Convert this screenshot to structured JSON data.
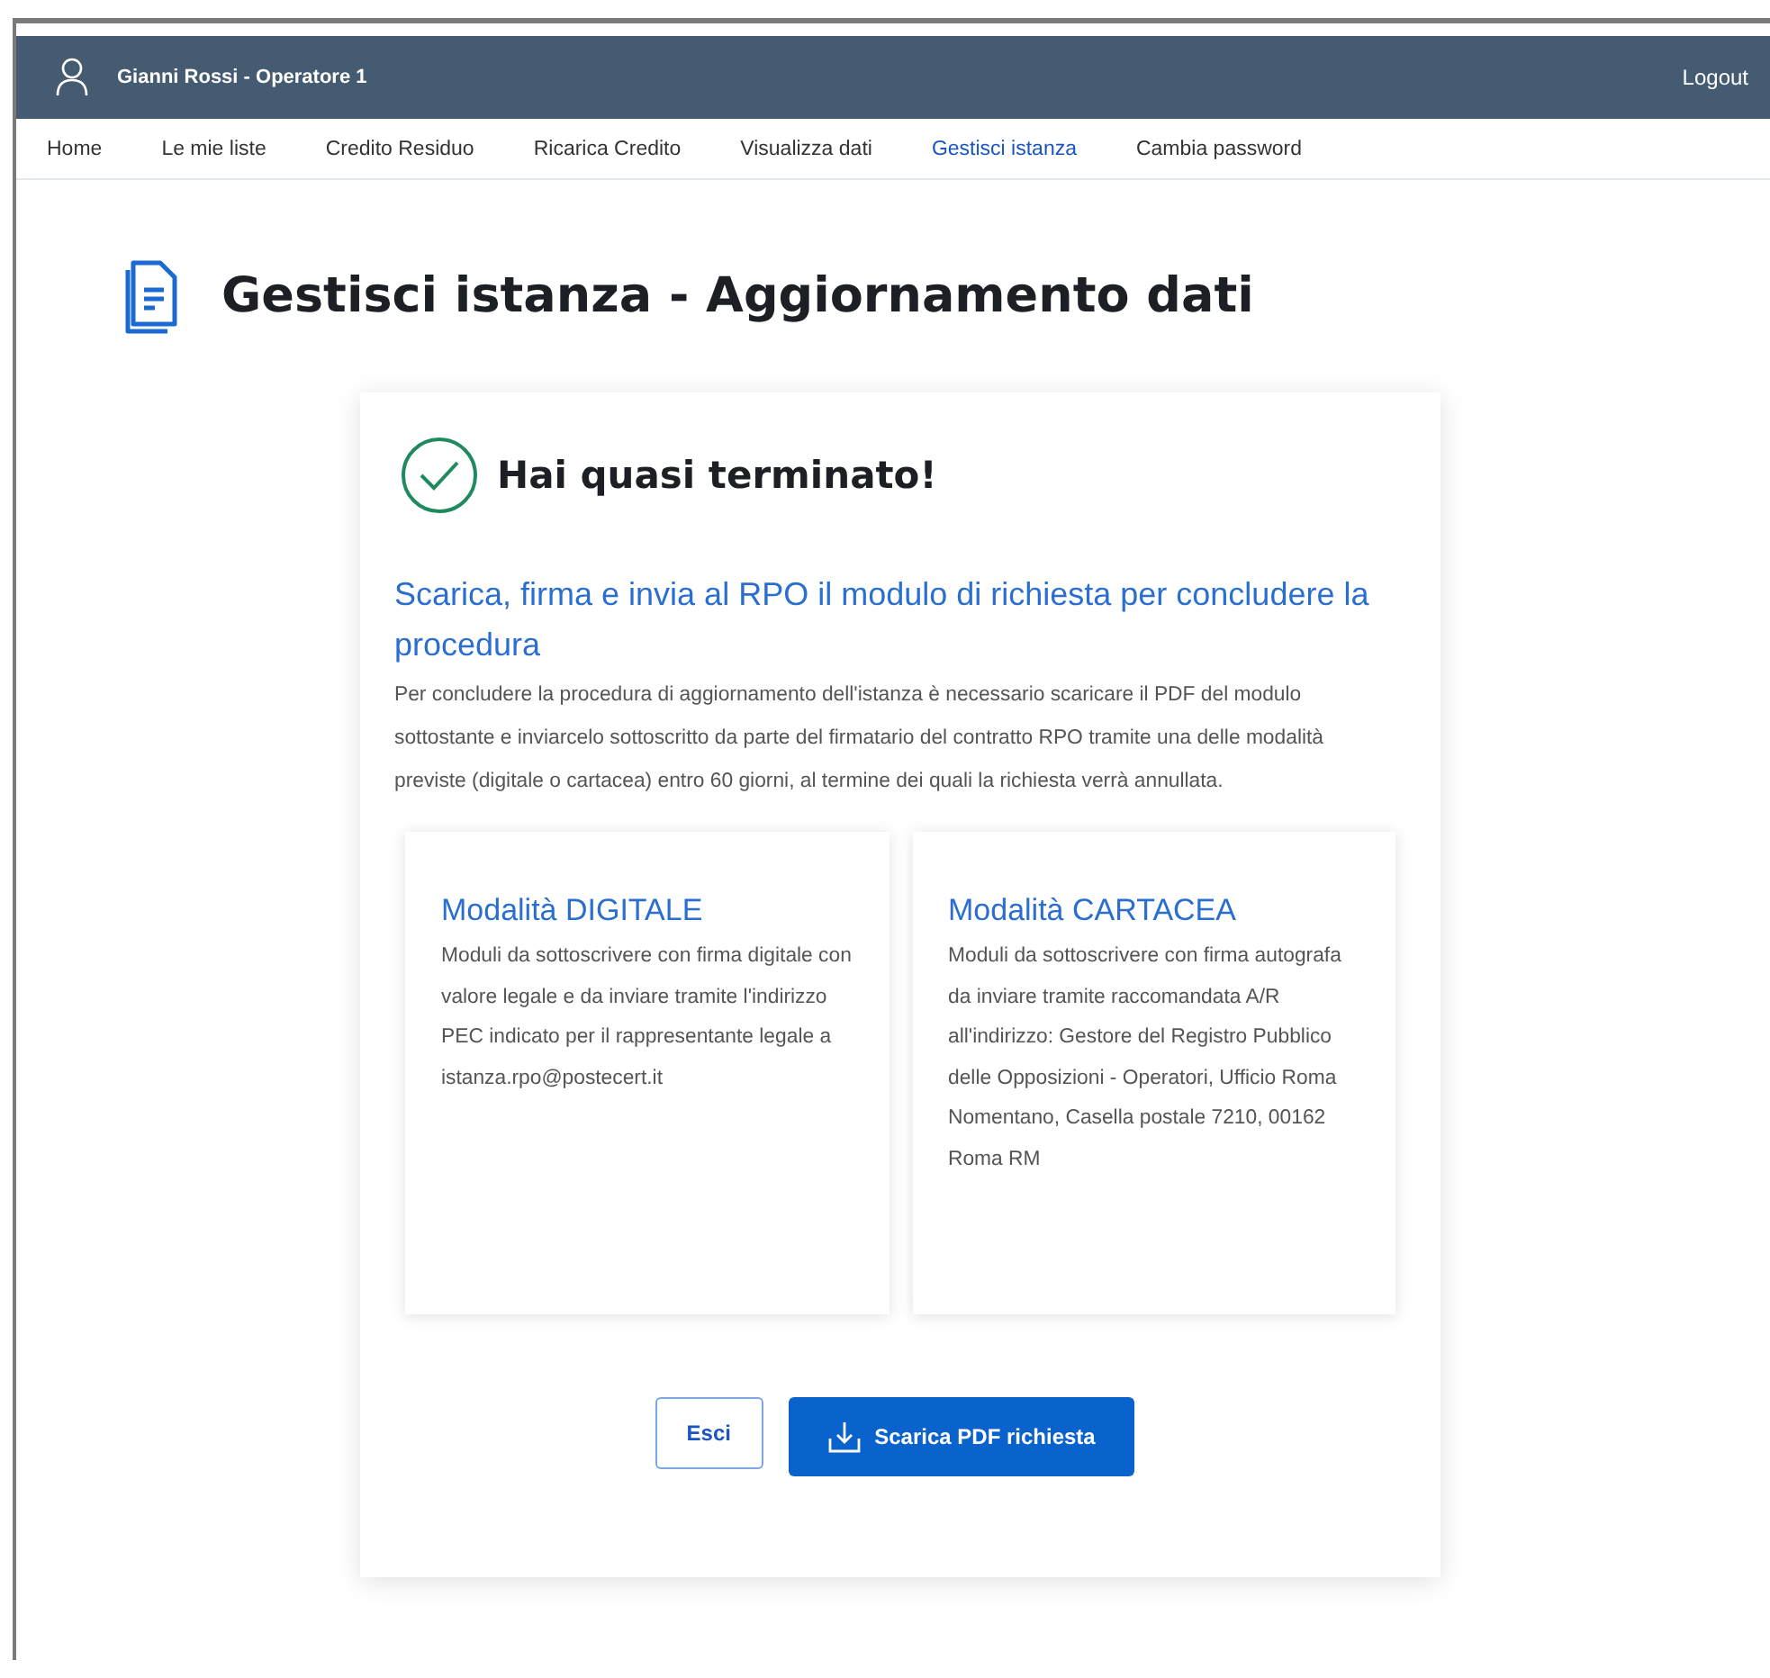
{
  "header": {
    "user": "Gianni Rossi - Operatore 1",
    "logout": "Logout"
  },
  "nav": [
    {
      "label": "Home",
      "selected": false
    },
    {
      "label": "Le mie liste",
      "selected": false
    },
    {
      "label": "Credito Residuo",
      "selected": false
    },
    {
      "label": "Ricarica Credito",
      "selected": false
    },
    {
      "label": "Visualizza dati",
      "selected": false
    },
    {
      "label": "Gestisci istanza",
      "selected": true
    },
    {
      "label": "Cambia password",
      "selected": false
    }
  ],
  "page_title": "Gestisci istanza - Aggiornamento dati",
  "card": {
    "heading": "Hai quasi terminato!",
    "subheading": "Scarica, firma e invia al RPO il modulo di richiesta per concludere la procedura",
    "text": "Per concludere la procedura di aggiornamento dell'istanza è necessario scaricare il PDF del modulo sottostante e inviarcelo sottoscritto da parte del firmatario del contratto RPO tramite una delle modalità previste (digitale o cartacea) entro 60 giorni, al termine dei quali la richiesta verrà annullata.",
    "modes": [
      {
        "title": "Modalità DIGITALE",
        "text": "Moduli da sottoscrivere con firma digitale con valore legale e da inviare tramite l'indirizzo PEC indicato per il rappresentante legale a istanza.rpo@postecert.it"
      },
      {
        "title": "Modalità CARTACEA",
        "text": "Moduli da sottoscrivere con firma autografa da inviare tramite raccomandata A/R all'indirizzo: Gestore del Registro Pubblico delle Opposizioni - Operatori, Ufficio Roma Nomentano, Casella postale 7210, 00162 Roma RM"
      }
    ],
    "buttons": [
      {
        "label": "Esci",
        "kind": "secondary"
      },
      {
        "label": "Scarica PDF richiesta",
        "kind": "download"
      }
    ]
  }
}
